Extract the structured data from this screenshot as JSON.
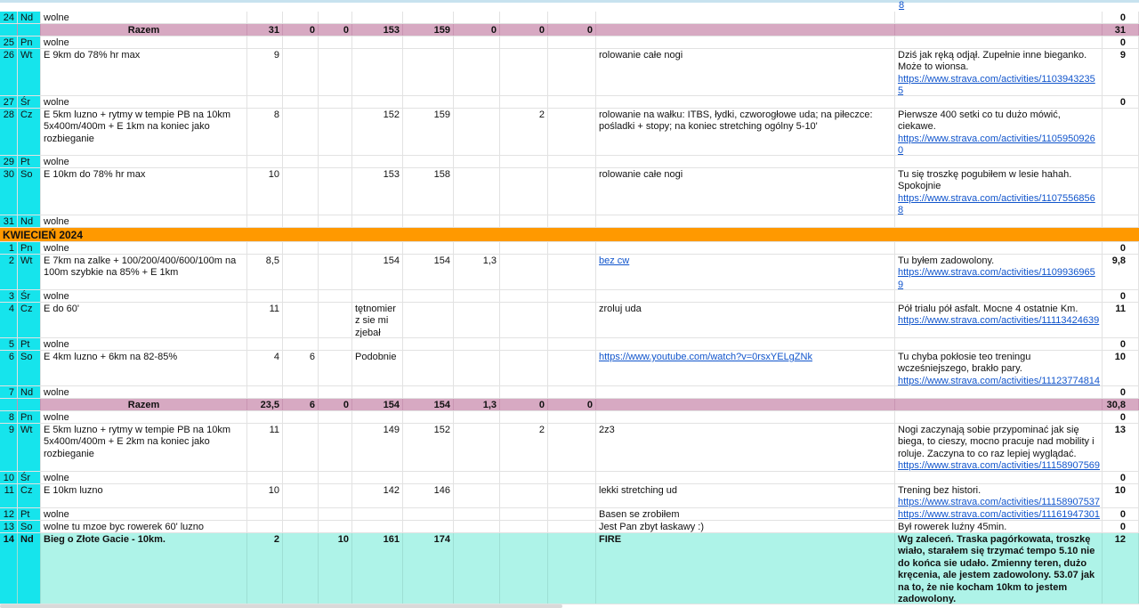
{
  "top_fragment": "8",
  "month_header": "KWIECIEŃ 2024",
  "rows": [
    {
      "day": "24",
      "dow": "Nd",
      "plan": "wolne",
      "total": "0"
    },
    {
      "sum": true,
      "plan": "Razem",
      "km": "31",
      "k2": "0",
      "k3": "0",
      "hr1": "153",
      "hr2": "159",
      "x1": "0",
      "x2": "0",
      "x3": "0",
      "total": "31"
    },
    {
      "day": "25",
      "dow": "Pn",
      "plan": "wolne",
      "total": "0"
    },
    {
      "day": "26",
      "dow": "Wt",
      "plan": "E 9km do 78% hr max",
      "km": "9",
      "ext": "rolowanie całe nogi",
      "comment": "Dziś jak ręką odjął. Zupełnie inne bieganko. Może to wionsa.",
      "link": "https://www.strava.com/activities/1103943235 5",
      "total": "9"
    },
    {
      "day": "27",
      "dow": "Śr",
      "plan": "wolne",
      "total": "0"
    },
    {
      "day": "28",
      "dow": "Cz",
      "plan": "E 5km luzno + rytmy w tempie PB na 10km 5x400m/400m + E 1km na koniec jako rozbieganie",
      "km": "8",
      "hr1": "152",
      "hr2": "159",
      "x2": "2",
      "ext": "rolowanie na wałku: ITBS, łydki, czworogłowe uda; na piłeczce: pośladki + stopy; na koniec stretching ogólny 5-10'",
      "comment": "Pierwsze 400 setki co tu dużo mówić, ciekawe.",
      "link": "https://www.strava.com/activities/1105950926 0"
    },
    {
      "day": "29",
      "dow": "Pt",
      "plan": "wolne"
    },
    {
      "day": "30",
      "dow": "So",
      "plan": "E 10km do 78% hr max",
      "km": "10",
      "hr1": "153",
      "hr2": "158",
      "ext": "rolowanie całe nogi",
      "comment": "Tu się troszkę pogubiłem w lesie hahah. Spokojnie",
      "link": "https://www.strava.com/activities/1107556856 8"
    },
    {
      "day": "31",
      "dow": "Nd",
      "plan": "wolne"
    },
    {
      "month": true
    },
    {
      "day": "1",
      "dow": "Pn",
      "plan": "wolne",
      "total": "0"
    },
    {
      "day": "2",
      "dow": "Wt",
      "plan": "E 7km na zalke + 100/200/400/600/100m na 100m szybkie na 85% + E 1km",
      "km": "8,5",
      "hr1": "154",
      "hr2": "154",
      "x1": "1,3",
      "ext": "bez cw",
      "ext_link": true,
      "comment": "Tu byłem zadowolony.",
      "link": "https://www.strava.com/activities/1109936965 9",
      "total": "9,8"
    },
    {
      "day": "3",
      "dow": "Śr",
      "plan": "wolne",
      "total": "0"
    },
    {
      "day": "4",
      "dow": "Cz",
      "plan": "E do 60'",
      "km": "11",
      "hr1_text": "tętnomier z sie mi zjebał",
      "ext": "zroluj uda",
      "comment": "Pół trialu pół asfalt. Mocne 4 ostatnie Km.",
      "link": "https://www.strava.com/activities/11113424639",
      "total": "11"
    },
    {
      "day": "5",
      "dow": "Pt",
      "plan": "wolne",
      "total": "0"
    },
    {
      "day": "6",
      "dow": "So",
      "plan": "E 4km luzno + 6km na 82-85%",
      "km": "4",
      "k2": "6",
      "hr1_text": "Podobnie",
      "ext": "https://www.youtube.com/watch?v=0rsxYELgZNk",
      "ext_link": true,
      "comment": "Tu chyba pokłosie teo treningu wcześniejszego, brakło pary.",
      "link": "https://www.strava.com/activities/11123774814",
      "total": "10"
    },
    {
      "day": "7",
      "dow": "Nd",
      "plan": "wolne",
      "total": "0"
    },
    {
      "sum": true,
      "plan": "Razem",
      "km": "23,5",
      "k2": "6",
      "k3": "0",
      "hr1": "154",
      "hr2": "154",
      "x1": "1,3",
      "x2": "0",
      "x3": "0",
      "total": "30,8"
    },
    {
      "day": "8",
      "dow": "Pn",
      "plan": "wolne",
      "total": "0"
    },
    {
      "day": "9",
      "dow": "Wt",
      "plan": "E 5km luzno + rytmy w tempie PB na 10km 5x400m/400m + E 2km na koniec jako rozbieganie",
      "km": "11",
      "hr1": "149",
      "hr2": "152",
      "x2": "2",
      "ext": "2z3",
      "comment": "Nogi zaczynają sobie przypominać jak się biega, to cieszy, mocno pracuje nad mobility i roluje. Zaczyna to co raz lepiej wyglądać.",
      "link": "https://www.strava.com/activities/11158907569",
      "total": "13"
    },
    {
      "day": "10",
      "dow": "Śr",
      "plan": "wolne",
      "total": "0"
    },
    {
      "day": "11",
      "dow": "Cz",
      "plan": "E 10km luzno",
      "km": "10",
      "hr1": "142",
      "hr2": "146",
      "ext": "lekki stretching ud",
      "comment": "Trening bez histori.",
      "link": "https://www.strava.com/activities/11158907537",
      "total": "10"
    },
    {
      "day": "12",
      "dow": "Pt",
      "plan": "wolne",
      "ext": "Basen se zrobiłem",
      "link": "https://www.strava.com/activities/11161947301",
      "total": "0"
    },
    {
      "day": "13",
      "dow": "So",
      "plan": "wolne tu mzoe byc rowerek 60' luzno",
      "ext": "Jest Pan zbyt łaskawy :)",
      "comment": "Był rowerek luźny 45min.",
      "total": "0"
    },
    {
      "race": true,
      "day": "14",
      "dow": "Nd",
      "plan": "Bieg o Złote Gacie - 10km.",
      "km": "2",
      "k3": "10",
      "hr1": "161",
      "hr2": "174",
      "ext": "FIRE",
      "comment": "Wg zaleceń. Traska pagórkowata, troszkę wiało, starałem się trzymać tempo 5.10 nie do końca sie udało. Zmienny teren, dużo kręcenia, ale jestem zadowolony. 53.07 jak na to, że nie kocham 10km to jestem zadowolony.",
      "total": "12"
    }
  ],
  "colors": {
    "day_col": "#16e4ec",
    "sum_row": "#d7a9c2",
    "month_row": "#ff9900",
    "race_row": "#aef3e8",
    "link": "#1155cc"
  }
}
